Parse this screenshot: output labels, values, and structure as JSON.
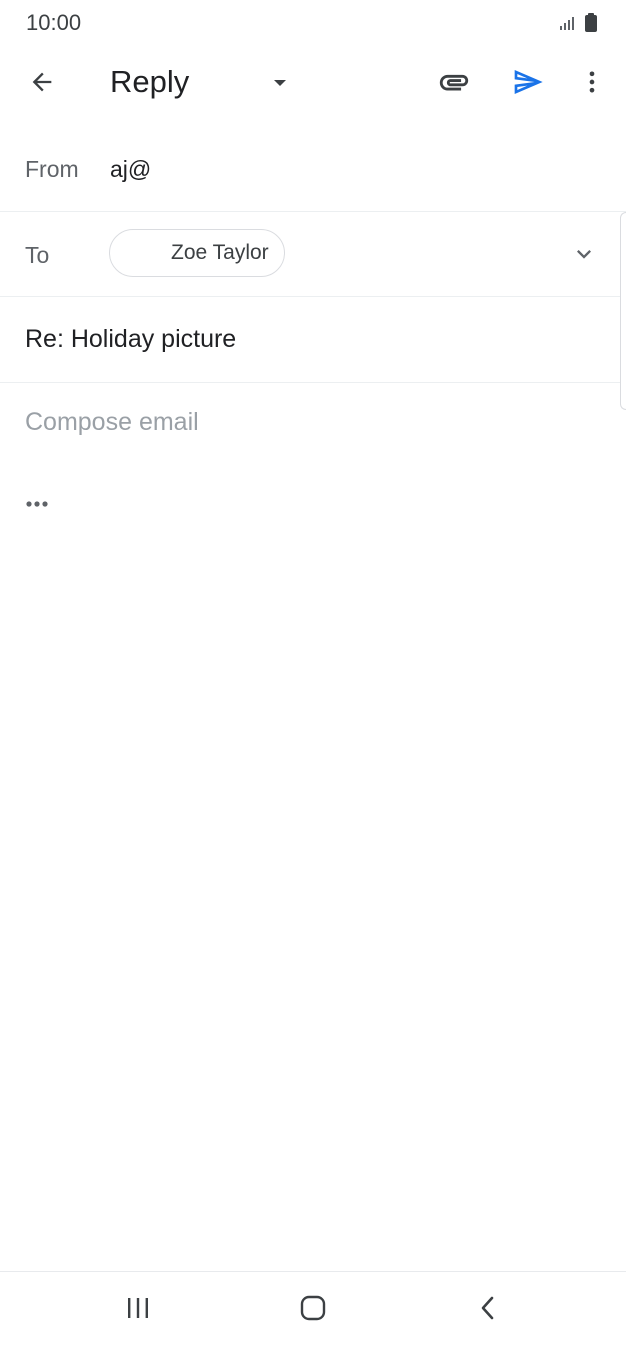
{
  "status_bar": {
    "time": "10:00",
    "icons": [
      "signal-icon",
      "battery-icon"
    ]
  },
  "app_bar": {
    "title": "Reply",
    "icons": {
      "back": "arrow-back-icon",
      "dropdown": "caret-down-icon",
      "attach": "paperclip-icon",
      "send": "send-icon",
      "more": "more-vert-icon"
    },
    "send_color": "#1a73e8"
  },
  "compose": {
    "from_label": "From",
    "from_value": "aj@",
    "to_label": "To",
    "recipients": [
      "Zoe Taylor"
    ],
    "subject": "Re: Holiday picture",
    "body_placeholder": "Compose email",
    "quoted_text_icon": "more-horiz-icon"
  },
  "nav_bar": {
    "buttons": [
      "recent-apps-icon",
      "home-icon",
      "back-icon"
    ]
  }
}
